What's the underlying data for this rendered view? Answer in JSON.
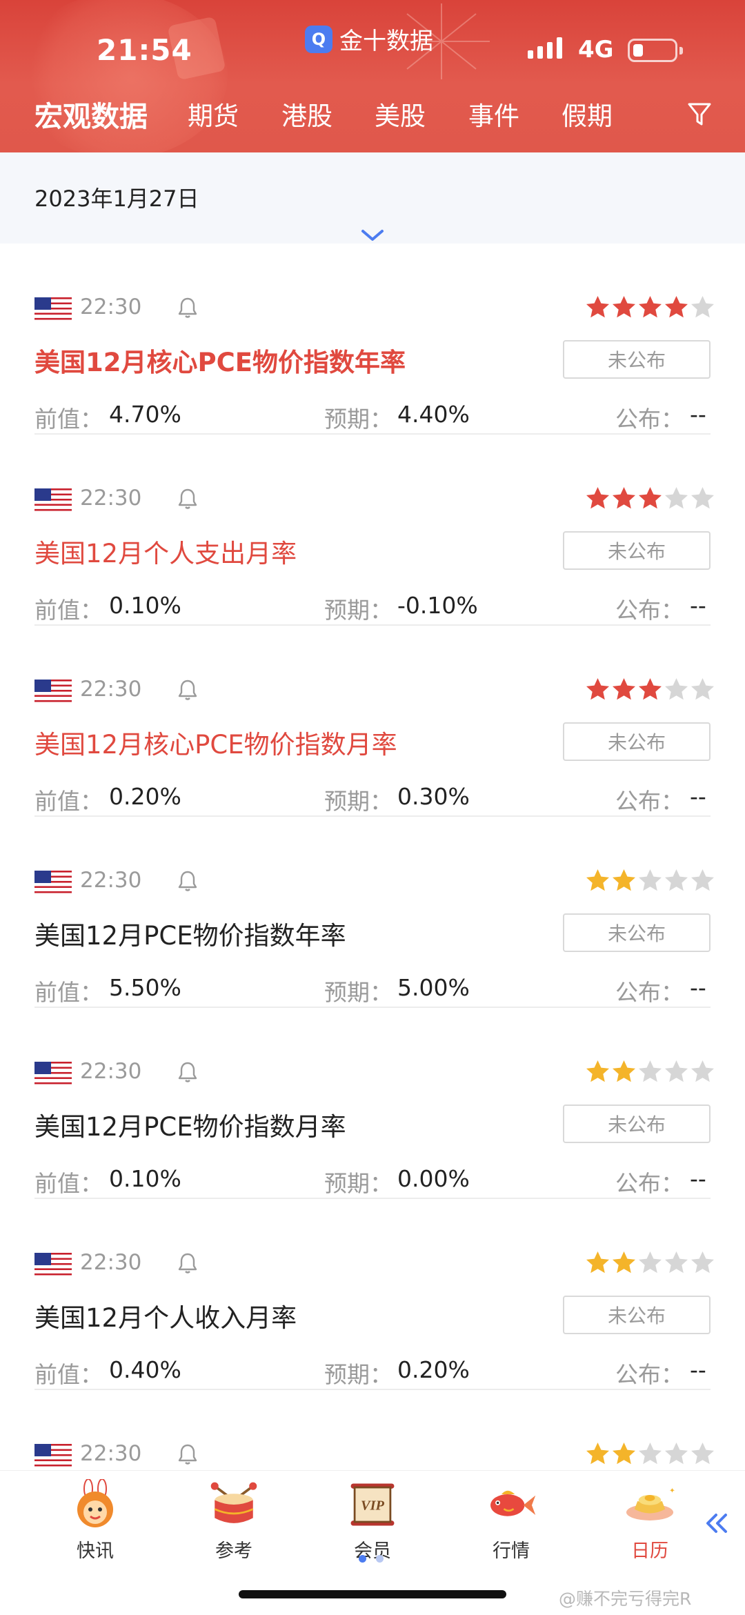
{
  "status_bar": {
    "time": "21:54",
    "network": "4G"
  },
  "app": {
    "title": "金十数据",
    "logo_text": "Q"
  },
  "tabs": [
    {
      "label": "宏观数据",
      "active": true
    },
    {
      "label": "期货",
      "active": false
    },
    {
      "label": "港股",
      "active": false
    },
    {
      "label": "美股",
      "active": false
    },
    {
      "label": "事件",
      "active": false
    },
    {
      "label": "假期",
      "active": false
    }
  ],
  "date": "2023年1月27日",
  "labels": {
    "prev": "前值：",
    "forecast": "预期：",
    "actual": "公布："
  },
  "events": [
    {
      "time": "22:30",
      "stars": 4,
      "star_color": "red",
      "title": "美国12月核心PCE物价指数年率",
      "highlight": true,
      "bold": true,
      "status": "未公布",
      "prev": "4.70%",
      "forecast": "4.40%",
      "actual": "--"
    },
    {
      "time": "22:30",
      "stars": 3,
      "star_color": "red",
      "title": "美国12月个人支出月率",
      "highlight": true,
      "bold": false,
      "status": "未公布",
      "prev": "0.10%",
      "forecast": "-0.10%",
      "actual": "--"
    },
    {
      "time": "22:30",
      "stars": 3,
      "star_color": "red",
      "title": "美国12月核心PCE物价指数月率",
      "highlight": true,
      "bold": false,
      "status": "未公布",
      "prev": "0.20%",
      "forecast": "0.30%",
      "actual": "--"
    },
    {
      "time": "22:30",
      "stars": 2,
      "star_color": "gold",
      "title": "美国12月PCE物价指数年率",
      "highlight": false,
      "bold": false,
      "status": "未公布",
      "prev": "5.50%",
      "forecast": "5.00%",
      "actual": "--"
    },
    {
      "time": "22:30",
      "stars": 2,
      "star_color": "gold",
      "title": "美国12月PCE物价指数月率",
      "highlight": false,
      "bold": false,
      "status": "未公布",
      "prev": "0.10%",
      "forecast": "0.00%",
      "actual": "--"
    },
    {
      "time": "22:30",
      "stars": 2,
      "star_color": "gold",
      "title": "美国12月个人收入月率",
      "highlight": false,
      "bold": false,
      "status": "未公布",
      "prev": "0.40%",
      "forecast": "0.20%",
      "actual": "--"
    },
    {
      "time": "22:30",
      "stars": 2,
      "star_color": "gold",
      "title": "",
      "highlight": false,
      "bold": false,
      "status": "",
      "prev": "",
      "forecast": "",
      "actual": ""
    }
  ],
  "bottom_nav": [
    {
      "label": "快讯",
      "icon": "rabbit-icon",
      "active": false
    },
    {
      "label": "参考",
      "icon": "drum-icon",
      "active": false
    },
    {
      "label": "会员",
      "icon": "vip-scroll-icon",
      "vip_text": "VIP",
      "active": false
    },
    {
      "label": "行情",
      "icon": "koi-fish-icon",
      "active": false
    },
    {
      "label": "日历",
      "icon": "gold-ingot-icon",
      "active": true
    }
  ],
  "watermark": "@赚不完亏得完R",
  "colors": {
    "header": "#e0534a",
    "highlight": "#e0493f",
    "star_red": "#e0493f",
    "star_gold": "#f4b42a",
    "star_empty": "#d6d6d6"
  }
}
